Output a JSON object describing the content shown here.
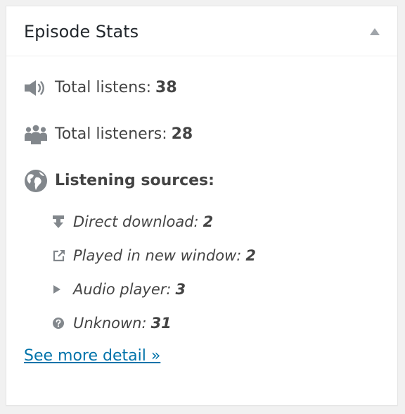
{
  "widget": {
    "title": "Episode Stats",
    "toggle_icon": "triangle-up-icon"
  },
  "stats": {
    "listens": {
      "icon": "speaker-icon",
      "label": "Total listens:",
      "value": "38"
    },
    "listeners": {
      "icon": "group-icon",
      "label": "Total listeners:",
      "value": "28"
    }
  },
  "sources": {
    "icon": "globe-icon",
    "heading": "Listening sources:",
    "items": [
      {
        "icon": "download-icon",
        "label": "Direct download:",
        "value": "2"
      },
      {
        "icon": "external-link-icon",
        "label": "Played in new window:",
        "value": "2"
      },
      {
        "icon": "play-icon",
        "label": "Audio player:",
        "value": "3"
      },
      {
        "icon": "question-icon",
        "label": "Unknown:",
        "value": "31"
      }
    ]
  },
  "link": {
    "label": "See more detail »"
  },
  "colors": {
    "link": "#0073aa",
    "text": "#444444",
    "icon": "#82878c",
    "background": "#f1f1f1",
    "panel": "#ffffff"
  }
}
